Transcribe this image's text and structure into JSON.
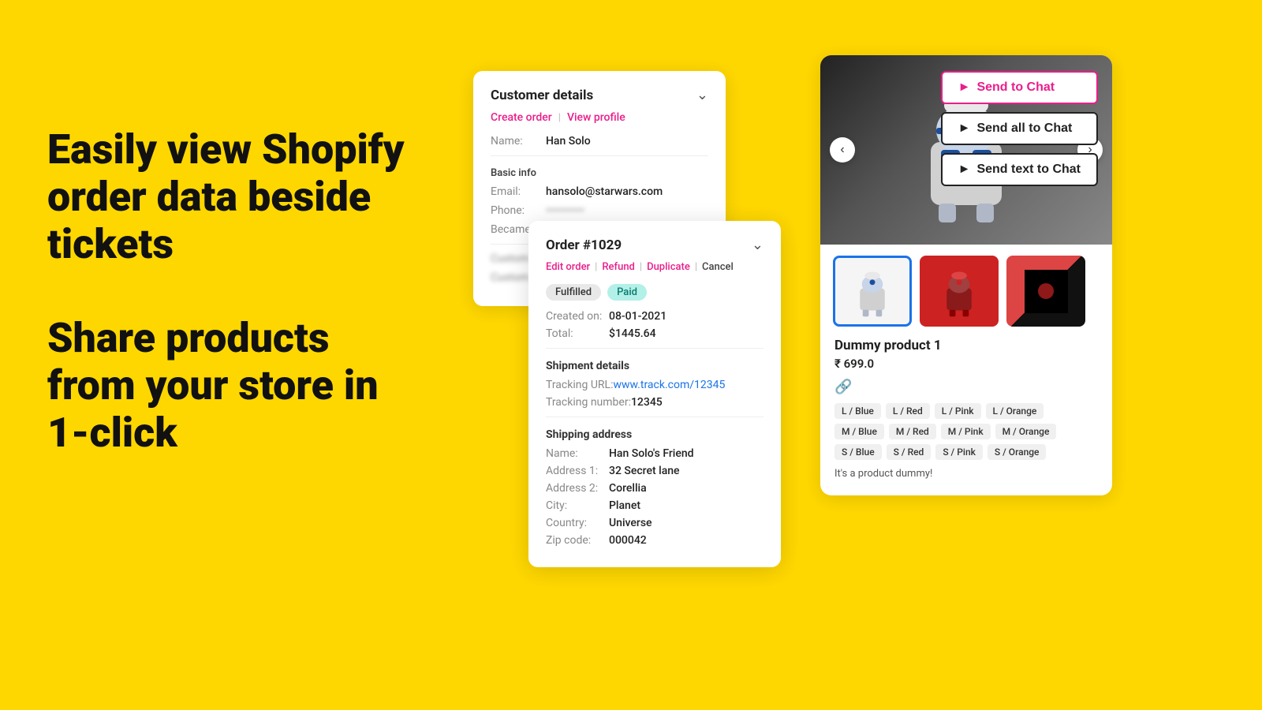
{
  "background": "#FFD700",
  "left": {
    "heading1": "Easily view Shopify order data beside tickets",
    "heading2": "Share products from your store in 1-click"
  },
  "customer_card": {
    "title": "Customer details",
    "action_create": "Create order",
    "divider": "|",
    "action_view": "View profile",
    "name_label": "Name:",
    "name_value": "Han Solo",
    "basic_info": "Basic info",
    "email_label": "Email:",
    "email_value": "hansolo@starwars.com",
    "phone_label": "Phone:",
    "phone_value": "••••••••••",
    "became_label": "Became:",
    "became_value": "••••••",
    "custom_label1": "Custom",
    "custom_label2": "Custom"
  },
  "order_card": {
    "title": "Order #1029",
    "action_edit": "Edit order",
    "divider1": "|",
    "action_refund": "Refund",
    "divider2": "|",
    "action_duplicate": "Duplicate",
    "divider3": "|",
    "action_cancel": "Cancel",
    "badge_fulfilled": "Fulfilled",
    "badge_paid": "Paid",
    "created_label": "Created on:",
    "created_value": "08-01-2021",
    "total_label": "Total:",
    "total_value": "$1445.64",
    "shipment_title": "Shipment details",
    "tracking_url_label": "Tracking URL:",
    "tracking_url": "www.track.com/12345",
    "tracking_number_label": "Tracking number:",
    "tracking_number": "12345",
    "shipping_title": "Shipping address",
    "ship_name_label": "Name:",
    "ship_name_value": "Han Solo's Friend",
    "addr1_label": "Address 1:",
    "addr1_value": "32 Secret lane",
    "addr2_label": "Address 2:",
    "addr2_value": "Corellia",
    "city_label": "City:",
    "city_value": "Planet",
    "country_label": "Country:",
    "country_value": "Universe",
    "zip_label": "Zip code:",
    "zip_value": "000042"
  },
  "product_card": {
    "send_to_chat": "Send to Chat",
    "send_all_to_chat": "Send all to Chat",
    "send_text_to_chat": "Send text to Chat",
    "product_name": "Dummy product 1",
    "product_price": "₹ 699.0",
    "product_desc": "It's a product dummy!",
    "variants": [
      "L / Blue",
      "L / Red",
      "L / Pink",
      "L / Orange",
      "M / Blue",
      "M / Red",
      "M / Pink",
      "M / Orange",
      "S / Blue",
      "S / Red",
      "S / Pink",
      "S / Orange"
    ]
  }
}
